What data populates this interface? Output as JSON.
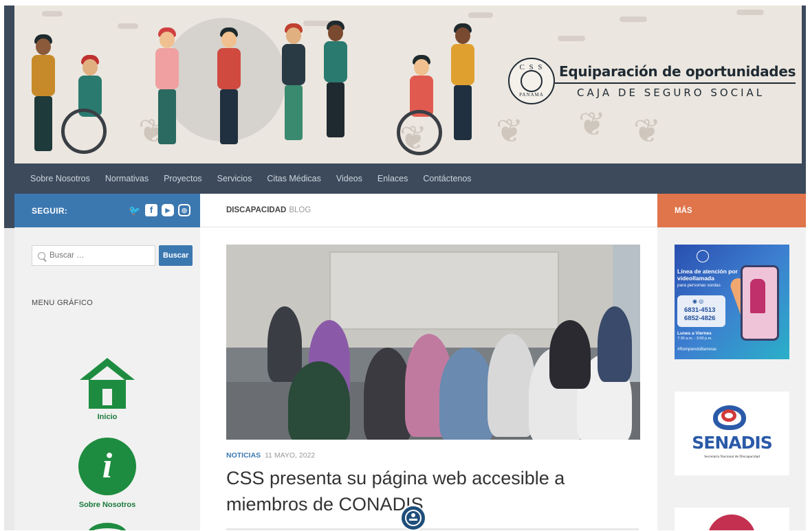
{
  "header": {
    "site_title": "Equiparación de oportunidades",
    "site_subtitle": "CAJA DE SEGURO SOCIAL",
    "logo_top": "C S S",
    "logo_bottom": "PANAMA"
  },
  "nav": {
    "items": [
      "Sobre Nosotros",
      "Normativas",
      "Proyectos",
      "Servicios",
      "Citas Médicas",
      "Videos",
      "Enlaces",
      "Contáctenos"
    ]
  },
  "left": {
    "follow_label": "SEGUIR:",
    "social_icons": [
      "twitter-icon",
      "facebook-icon",
      "youtube-icon",
      "instagram-icon"
    ],
    "search_placeholder": "Buscar …",
    "search_button": "Buscar",
    "menu_title": "MENU GRÁFICO",
    "menu_items": [
      "Inicio",
      "Sobre Nosotros"
    ]
  },
  "main": {
    "category": "DISCAPACIDAD",
    "section": "BLOG",
    "post_category": "NOTICIAS",
    "post_date": "11 MAYO, 2022",
    "post_title": "CSS presenta su página web accesible a miembros de CONADIS"
  },
  "right": {
    "header": "MÁS",
    "video_ad": {
      "line1": "Línea de atención por videollamada",
      "line2": "para personas sordas",
      "phone1": "6831-4513",
      "phone2": "6852-4826",
      "days": "Lunes a Viernes",
      "hours": "7:30 a.m. - 3:00 p.m.",
      "hashtag": "#RompiendoBarreras"
    },
    "senadis": {
      "name": "SENADIS",
      "subtitle": "Secretaría Nacional de Discapacidad"
    }
  },
  "colors": {
    "nav_bg": "#3c4a5c",
    "follow_bg": "#3c78b0",
    "more_bg": "#e0744a",
    "menu_green": "#1e8c40"
  }
}
